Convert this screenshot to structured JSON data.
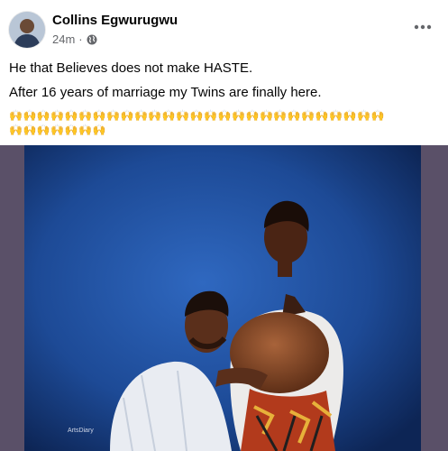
{
  "post": {
    "author": "Collins Egwurugwu",
    "time": "24m",
    "separator": "·",
    "privacy_icon": "globe-icon",
    "more_icon": "more-options-icon",
    "lines": [
      "He that Believes does not make HASTE.",
      "After 16 years of marriage my Twins are finally here."
    ],
    "emoji_row_1": "🙌🙌🙌🙌🙌🙌🙌🙌🙌🙌🙌🙌🙌🙌🙌🙌🙌🙌🙌🙌🙌🙌🙌🙌🙌🙌🙌",
    "emoji_row_2": "🙌🙌🙌🙌🙌🙌🙌",
    "photo_watermark": "ArtsDiary"
  },
  "colors": {
    "text": "#050505",
    "secondary": "#65676b",
    "photo_frame": "#5a5068",
    "photo_background": "#1f4f9e"
  }
}
